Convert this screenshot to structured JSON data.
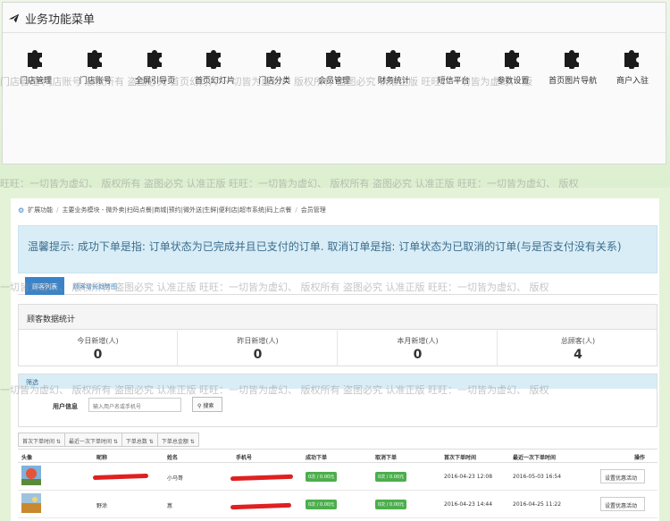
{
  "menu_panel": {
    "title": "业务功能菜单",
    "items": [
      {
        "label": "门店管理",
        "icon": "puzzle-icon"
      },
      {
        "label": "门店账号",
        "icon": "puzzle-icon"
      },
      {
        "label": "全屏引导页",
        "icon": "puzzle-icon"
      },
      {
        "label": "首页幻灯片",
        "icon": "puzzle-icon"
      },
      {
        "label": "门店分类",
        "icon": "puzzle-icon"
      },
      {
        "label": "会员管理",
        "icon": "puzzle-icon"
      },
      {
        "label": "财务统计",
        "icon": "puzzle-icon"
      },
      {
        "label": "短信平台",
        "icon": "puzzle-icon"
      },
      {
        "label": "参数设置",
        "icon": "puzzle-icon"
      },
      {
        "label": "首页图片导航",
        "icon": "puzzle-icon"
      },
      {
        "label": "商户入驻",
        "icon": "puzzle-icon"
      }
    ]
  },
  "watermark": {
    "line1": "门店管理  门店账号  版权所有  盗图必究  首页幻灯片  一切皆为虚幻、  版权所有  盗图必究  认准正版  旺旺：一切皆为虚幻、  版",
    "line2": "旺旺：一切皆为虚幻、  版权所有  盗图必究  认准正版      旺旺：一切皆为虚幻、  版权所有  盗图必究  认准正版      旺旺：一切皆为虚幻、  版权",
    "line3": "一切皆为虚幻、  版权所有  盗图必究  认准正版      旺旺：一切皆为虚幻、  版权所有  盗图必究  认准正版      旺旺：一切皆为虚幻、  版权",
    "line4": "一切皆为虚幻、  版权所有  盗图必究  认准正版      旺旺：一切皆为虚幻、  版权所有  盗图必究  认准正版      旺旺：一切皆为虚幻、  版权"
  },
  "breadcrumb": {
    "items": [
      "扩展功能",
      "主要业务模块 - 微外卖|扫码点餐|商城|预约|微外送|生鲜|便利店|超市系统|码上点餐",
      "会员管理"
    ]
  },
  "alert": {
    "text": "温馨提示: 成功下单是指: 订单状态为已完成并且已支付的订单. 取消订单是指: 订单状态为已取消的订单(与是否支付没有关系)"
  },
  "tabs": {
    "active": "顾客列表",
    "inactive": "顾客增长趋势图"
  },
  "stats": {
    "title": "顾客数据统计",
    "items": [
      {
        "label": "今日新增(人)",
        "value": "0"
      },
      {
        "label": "昨日新增(人)",
        "value": "0"
      },
      {
        "label": "本月新增(人)",
        "value": "0"
      },
      {
        "label": "总顾客(人)",
        "value": "4"
      }
    ]
  },
  "filter": {
    "title": "筛选",
    "label": "用户信息",
    "placeholder": "输入用户名或手机号",
    "search_button": "搜索"
  },
  "sort_buttons": [
    "首次下单时间 ⇅",
    "最近一次下单时间 ⇅",
    "下单总数 ⇅",
    "下单总金额 ⇅"
  ],
  "table": {
    "headers": [
      "头像",
      "昵称",
      "姓名",
      "手机号",
      "成功下单",
      "取消下单",
      "首次下单时间",
      "最近一次下单时间",
      "操作"
    ],
    "rows": [
      {
        "nickname": "",
        "name": "小马哥",
        "phone": "",
        "success": "0次 / 0.00元",
        "cancel": "0次 / 0.00元",
        "first": "2016-04-23 12:08",
        "last": "2016-05-03 16:54",
        "action": "设置优惠活动"
      },
      {
        "nickname": "野涂",
        "name": "蒽",
        "phone": "",
        "success": "0次 / 0.00元",
        "cancel": "0次 / 0.00元",
        "first": "2016-04-23 14:44",
        "last": "2016-04-25 11:22",
        "action": "设置优惠活动"
      }
    ]
  },
  "colors": {
    "primary": "#3b83c8",
    "alert_bg": "#d9edf7",
    "badge": "#4cae4c",
    "redaction": "#e02020"
  }
}
